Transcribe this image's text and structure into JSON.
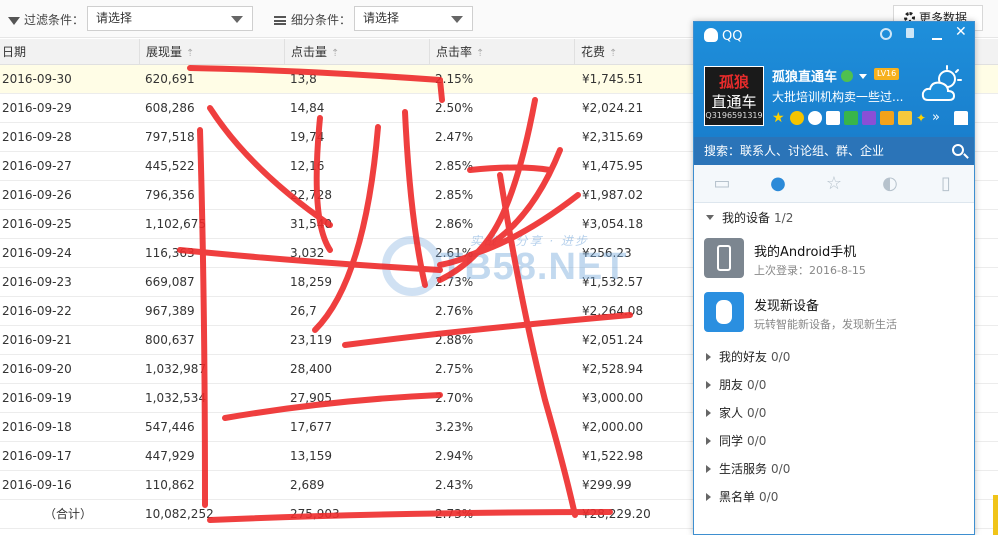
{
  "filter": {
    "label1": "过滤条件：",
    "select1": "请选择",
    "label2": "细分条件：",
    "select2": "请选择",
    "more_button": "更多数据"
  },
  "table": {
    "headers": [
      "日期",
      "展现量",
      "点击量",
      "点击率",
      "花费"
    ],
    "sort_glyph": "⇡",
    "rows": [
      [
        "2016-09-30",
        "620,691",
        "13,8",
        "2.15%",
        "¥1,745.51"
      ],
      [
        "2016-09-29",
        "608,286",
        "14,84",
        "2.50%",
        "¥2,024.21"
      ],
      [
        "2016-09-28",
        "797,518",
        "19,74",
        "2.47%",
        "¥2,315.69"
      ],
      [
        "2016-09-27",
        "445,522",
        "12,16",
        "2.85%",
        "¥1,475.95"
      ],
      [
        "2016-09-26",
        "796,356",
        "22,728",
        "2.85%",
        "¥1,987.02"
      ],
      [
        "2016-09-25",
        "1,102,675",
        "31,540",
        "2.86%",
        "¥3,054.18"
      ],
      [
        "2016-09-24",
        "116,363",
        "3,032",
        "2.61%",
        "¥256.23"
      ],
      [
        "2016-09-23",
        "669,087",
        "18,259",
        "2.73%",
        "¥1,532.57"
      ],
      [
        "2016-09-22",
        "967,389",
        "26,7",
        "2.76%",
        "¥2,264.08"
      ],
      [
        "2016-09-21",
        "800,637",
        "23,119",
        "2.88%",
        "¥2,051.24"
      ],
      [
        "2016-09-20",
        "1,032,987",
        "28,400",
        "2.75%",
        "¥2,528.94"
      ],
      [
        "2016-09-19",
        "1,032,534",
        "27,905",
        "2.70%",
        "¥3,000.00"
      ],
      [
        "2016-09-18",
        "547,446",
        "17,677",
        "3.23%",
        "¥2,000.00"
      ],
      [
        "2016-09-17",
        "447,929",
        "13,159",
        "2.94%",
        "¥1,522.98"
      ],
      [
        "2016-09-16",
        "110,862",
        "2,689",
        "2.43%",
        "¥299.99"
      ]
    ],
    "total": [
      "（合计）",
      "10,082,252",
      "275,903",
      "2.73%",
      "¥28,229.20"
    ]
  },
  "watermark": {
    "text": "TB58.NET",
    "sub": "实战 · 分享 · 进步"
  },
  "qq": {
    "title": "QQ",
    "nickname": "孤狼直通车",
    "level": "LV16",
    "signature": "大批培训机构卖一些过...",
    "avatar_line1": "孤狼",
    "avatar_line2": "直通车",
    "avatar_line3": "Q3196591319",
    "search_placeholder": "搜索：联系人、讨论组、群、企业",
    "tabs": [
      "message-icon",
      "contact-icon",
      "star-icon",
      "group-icon",
      "phone-icon"
    ],
    "my_devices": {
      "label": "我的设备",
      "count": "1/2"
    },
    "devices": [
      {
        "name": "我的Android手机",
        "sub": "上次登录：2016-8-15"
      },
      {
        "name": "发现新设备",
        "sub": "玩转智能新设备，发现新生活"
      }
    ],
    "groups": [
      {
        "label": "我的好友",
        "count": "0/0"
      },
      {
        "label": "朋友",
        "count": "0/0"
      },
      {
        "label": "家人",
        "count": "0/0"
      },
      {
        "label": "同学",
        "count": "0/0"
      },
      {
        "label": "生活服务",
        "count": "0/0"
      },
      {
        "label": "黑名单",
        "count": "0/0"
      }
    ],
    "colors": {
      "header": "#1e8fdb",
      "accent": "#2b8ad8"
    }
  }
}
